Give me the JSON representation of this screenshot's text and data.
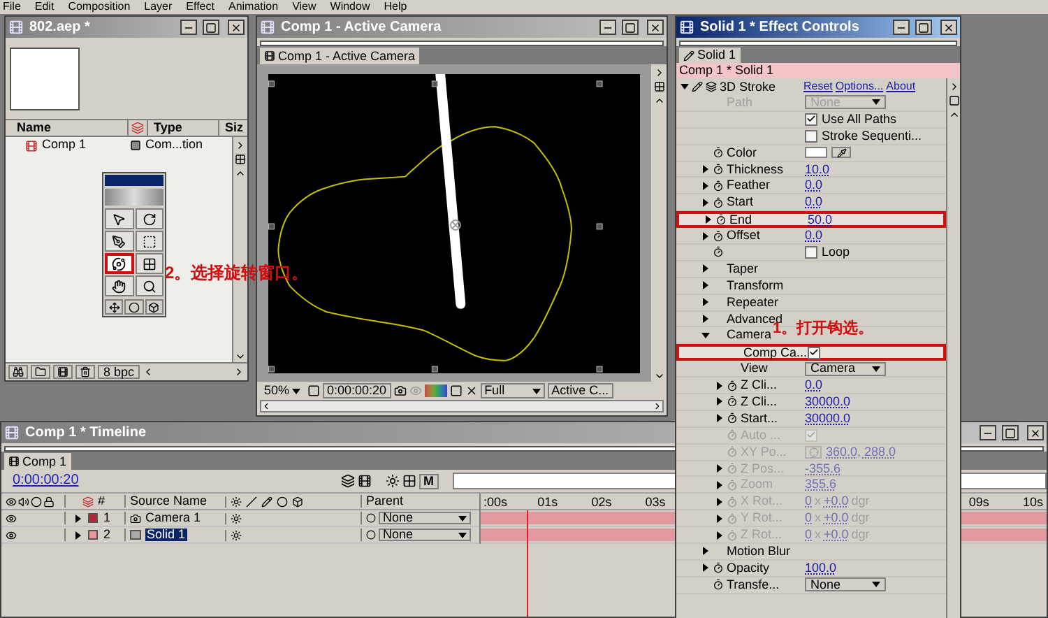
{
  "menu_bar": [
    "File",
    "Edit",
    "Composition",
    "Layer",
    "Effect",
    "Animation",
    "View",
    "Window",
    "Help"
  ],
  "project": {
    "title": "802.aep *",
    "columns": [
      "Name",
      "Type",
      "Siz"
    ],
    "items": [
      {
        "name": "Comp 1",
        "type": "Com...tion"
      }
    ],
    "bit_depth": "8 bpc",
    "tools": [
      {
        "kind": "arrow",
        "selected": false
      },
      {
        "kind": "rotate",
        "selected": false
      },
      {
        "kind": "pen",
        "selected": false
      },
      {
        "kind": "mask",
        "selected": false
      },
      {
        "kind": "orbit",
        "selected": true
      },
      {
        "kind": "track",
        "selected": false
      },
      {
        "kind": "hand",
        "selected": false
      },
      {
        "kind": "zoom",
        "selected": false
      }
    ],
    "annotation": "2。选择旋转窗口。"
  },
  "comp": {
    "title": "Comp 1 - Active Camera",
    "tab": "Comp 1 - Active Camera",
    "zoom": "50%",
    "time": "0:00:00:20",
    "resolution": "Full",
    "view": "Active C..."
  },
  "effect": {
    "title": "Solid 1 * Effect Controls",
    "tab": "Solid 1",
    "breadcrumb": "Comp 1 * Solid 1",
    "effect_name": "3D Stroke",
    "reset": "Reset",
    "options": "Options...",
    "about": "About",
    "annotation": "1。打开钩选。",
    "rows": [
      {
        "kind": "dropdown",
        "label": "Path",
        "value": "None",
        "twirl": false,
        "stopwatch": false,
        "disabled": true,
        "highlighted": false
      },
      {
        "kind": "checkbox",
        "text": "Use All Paths",
        "checked": true,
        "twirl": false,
        "stopwatch": false,
        "disabled": false,
        "highlighted": false
      },
      {
        "kind": "checkbox",
        "text": "Stroke Sequenti...",
        "checked": false,
        "twirl": false,
        "stopwatch": false,
        "disabled": false,
        "highlighted": false
      },
      {
        "kind": "color",
        "label": "Color",
        "twirl": false,
        "stopwatch": true,
        "disabled": false,
        "highlighted": false
      },
      {
        "kind": "value",
        "label": "Thickness",
        "value": "10.0",
        "twirl": true,
        "stopwatch": true,
        "disabled": false,
        "highlighted": false
      },
      {
        "kind": "value",
        "label": "Feather",
        "value": "0.0",
        "twirl": true,
        "stopwatch": true,
        "disabled": false,
        "highlighted": false
      },
      {
        "kind": "value",
        "label": "Start",
        "value": "0.0",
        "twirl": true,
        "stopwatch": true,
        "disabled": false,
        "highlighted": false
      },
      {
        "kind": "value",
        "label": "End",
        "value": "50.0",
        "twirl": true,
        "stopwatch": true,
        "disabled": false,
        "highlighted": true
      },
      {
        "kind": "value",
        "label": "Offset",
        "value": "0.0",
        "twirl": true,
        "stopwatch": true,
        "disabled": false,
        "highlighted": false
      },
      {
        "kind": "checkbox",
        "text": "Loop",
        "checked": false,
        "twirl": false,
        "stopwatch": true,
        "disabled": false,
        "highlighted": false
      },
      {
        "kind": "group",
        "label": "Taper",
        "twirl": true,
        "expanded": false,
        "stopwatch": false,
        "disabled": false,
        "highlighted": false
      },
      {
        "kind": "group",
        "label": "Transform",
        "twirl": true,
        "expanded": false,
        "stopwatch": false,
        "disabled": false,
        "highlighted": false
      },
      {
        "kind": "group",
        "label": "Repeater",
        "twirl": true,
        "expanded": false,
        "stopwatch": false,
        "disabled": false,
        "highlighted": false
      },
      {
        "kind": "group",
        "label": "Advanced",
        "twirl": true,
        "expanded": false,
        "stopwatch": false,
        "disabled": false,
        "highlighted": false
      },
      {
        "kind": "group",
        "label": "Camera",
        "twirl": true,
        "expanded": true,
        "stopwatch": false,
        "disabled": false,
        "highlighted": false,
        "children": [
          {
            "kind": "checkbox",
            "label": "Comp Ca...",
            "checked": true,
            "twirl": false,
            "stopwatch": false,
            "disabled": false,
            "highlighted": true
          },
          {
            "kind": "dropdown",
            "label": "View",
            "value": "Camera",
            "twirl": false,
            "stopwatch": false,
            "disabled": false,
            "highlighted": false
          },
          {
            "kind": "value",
            "label": "Z Cli...",
            "value": "0.0",
            "twirl": true,
            "stopwatch": true,
            "disabled": false,
            "highlighted": false
          },
          {
            "kind": "value",
            "label": "Z Cli...",
            "value": "30000.0",
            "twirl": true,
            "stopwatch": true,
            "disabled": false,
            "highlighted": false
          },
          {
            "kind": "value",
            "label": "Start...",
            "value": "30000.0",
            "twirl": true,
            "stopwatch": true,
            "disabled": false,
            "highlighted": false
          },
          {
            "kind": "checkbox",
            "label": "Auto ...",
            "checked": true,
            "twirl": false,
            "stopwatch": true,
            "disabled": true,
            "highlighted": false
          },
          {
            "kind": "xy",
            "label": "XY Po...",
            "value": "360.0, 288.0",
            "twirl": false,
            "stopwatch": true,
            "disabled": true,
            "highlighted": false
          },
          {
            "kind": "value",
            "label": "Z Pos...",
            "value": "-355.6",
            "twirl": true,
            "stopwatch": true,
            "disabled": true,
            "highlighted": false
          },
          {
            "kind": "value",
            "label": "Zoom",
            "value": "355.6",
            "twirl": true,
            "stopwatch": true,
            "disabled": true,
            "highlighted": false
          },
          {
            "kind": "rotation",
            "label": "X Rot...",
            "turns": "0",
            "sep": "x",
            "degrees": "+0.0",
            "unit": "dgr",
            "twirl": true,
            "stopwatch": true,
            "disabled": true,
            "highlighted": false
          },
          {
            "kind": "rotation",
            "label": "Y Rot...",
            "turns": "0",
            "sep": "x",
            "degrees": "+0.0",
            "unit": "dgr",
            "twirl": true,
            "stopwatch": true,
            "disabled": true,
            "highlighted": false
          },
          {
            "kind": "rotation",
            "label": "Z Rot...",
            "turns": "0",
            "sep": "x",
            "degrees": "+0.0",
            "unit": "dgr",
            "twirl": true,
            "stopwatch": true,
            "disabled": true,
            "highlighted": false
          }
        ]
      },
      {
        "kind": "group",
        "label": "Motion Blur",
        "twirl": true,
        "expanded": false,
        "stopwatch": false,
        "disabled": false,
        "highlighted": false
      },
      {
        "kind": "value",
        "label": "Opacity",
        "value": "100.0",
        "twirl": true,
        "stopwatch": true,
        "disabled": false,
        "highlighted": false
      },
      {
        "kind": "dropdown",
        "label": "Transfe...",
        "value": "None",
        "twirl": false,
        "stopwatch": true,
        "disabled": false,
        "highlighted": false
      }
    ]
  },
  "timeline": {
    "title": "Comp 1 * Timeline",
    "tab": "Comp 1",
    "time": "0:00:00:20",
    "marker_button": "M",
    "number_header": "#",
    "source_header": "Source Name",
    "parent_header": "Parent",
    "layers": [
      {
        "number": "1",
        "name": "Camera 1",
        "kind": "camera",
        "color": "#b02838",
        "parent": "None",
        "selected": false
      },
      {
        "number": "2",
        "name": "Solid 1",
        "kind": "solid",
        "color": "#e89898",
        "parent": "None",
        "selected": true
      }
    ],
    "ruler": [
      ":00s",
      "01s",
      "02s",
      "03s",
      "09s",
      "10s"
    ]
  }
}
